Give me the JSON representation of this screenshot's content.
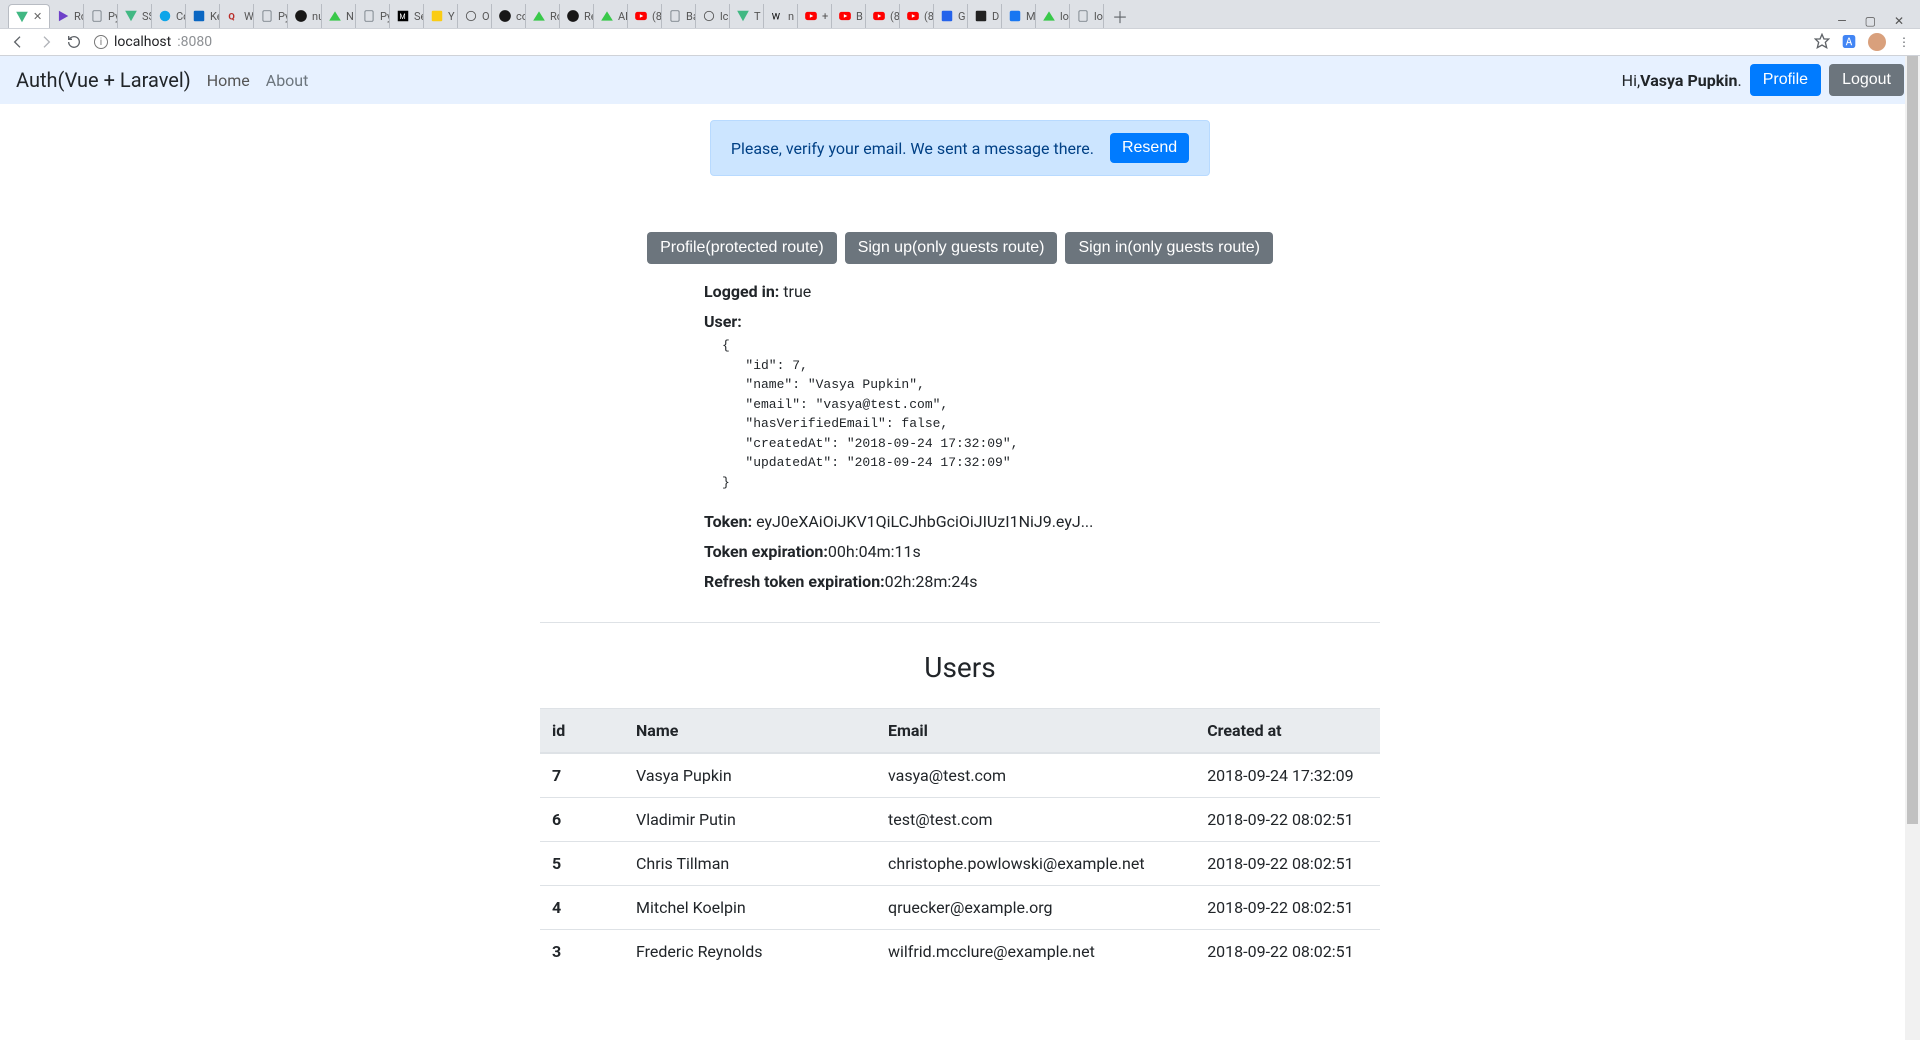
{
  "browser": {
    "address": {
      "host": "localhost",
      "port": ":8080"
    },
    "tabs": [
      {
        "id": "active",
        "label": ""
      },
      {
        "label": "lo"
      },
      {
        "label": "lo"
      },
      {
        "label": "M"
      },
      {
        "label": "D"
      },
      {
        "label": "G"
      },
      {
        "label": "(8"
      },
      {
        "label": "(8"
      },
      {
        "label": "B"
      },
      {
        "label": "+"
      },
      {
        "label": "n"
      },
      {
        "label": "T"
      },
      {
        "label": "lc"
      },
      {
        "label": "Ba"
      },
      {
        "label": "(8"
      },
      {
        "label": "AF"
      },
      {
        "label": "Re"
      },
      {
        "label": "Rc"
      },
      {
        "label": "co"
      },
      {
        "label": "O"
      },
      {
        "label": "Y"
      },
      {
        "label": "Se"
      },
      {
        "label": "Py"
      },
      {
        "label": "N"
      },
      {
        "label": "nu"
      },
      {
        "label": "Py"
      },
      {
        "label": "W"
      },
      {
        "label": "Ke"
      },
      {
        "label": "Cc"
      },
      {
        "label": "SS"
      },
      {
        "label": "Py"
      },
      {
        "label": "Rc"
      }
    ]
  },
  "navbar": {
    "brand": "Auth(Vue + Laravel)",
    "links": {
      "home": "Home",
      "about": "About"
    },
    "greeting_prefix": "Hi,",
    "user_name": "Vasya Pupkin",
    "greeting_suffix": ".",
    "profile_label": "Profile",
    "logout_label": "Logout"
  },
  "alert": {
    "text": "Please, verify your email. We sent a message there.",
    "resend_label": "Resend"
  },
  "buttons": {
    "profile": "Profile(protected route)",
    "signup": "Sign up(only guests route)",
    "signin": "Sign in(only guests route)"
  },
  "info": {
    "logged_in_label": "Logged in:",
    "logged_in_value": "true",
    "user_label": "User:",
    "user_json": "{\n   \"id\": 7,\n   \"name\": \"Vasya Pupkin\",\n   \"email\": \"vasya@test.com\",\n   \"hasVerifiedEmail\": false,\n   \"createdAt\": \"2018-09-24 17:32:09\",\n   \"updatedAt\": \"2018-09-24 17:32:09\"\n}",
    "token_label": "Token:",
    "token_value": "eyJ0eXAiOiJKV1QiLCJhbGciOiJIUzI1NiJ9.eyJ...",
    "token_exp_label": "Token expiration:",
    "token_exp_value": "00h:04m:11s",
    "refresh_exp_label": "Refresh token expiration:",
    "refresh_exp_value": "02h:28m:24s"
  },
  "users_section": {
    "title": "Users",
    "columns": {
      "id": "id",
      "name": "Name",
      "email": "Email",
      "created": "Created at"
    },
    "rows": [
      {
        "id": "7",
        "name": "Vasya Pupkin",
        "email": "vasya@test.com",
        "created": "2018-09-24 17:32:09"
      },
      {
        "id": "6",
        "name": "Vladimir Putin",
        "email": "test@test.com",
        "created": "2018-09-22 08:02:51"
      },
      {
        "id": "5",
        "name": "Chris Tillman",
        "email": "christophe.powlowski@example.net",
        "created": "2018-09-22 08:02:51"
      },
      {
        "id": "4",
        "name": "Mitchel Koelpin",
        "email": "qruecker@example.org",
        "created": "2018-09-22 08:02:51"
      },
      {
        "id": "3",
        "name": "Frederic Reynolds",
        "email": "wilfrid.mcclure@example.net",
        "created": "2018-09-22 08:02:51"
      }
    ]
  }
}
